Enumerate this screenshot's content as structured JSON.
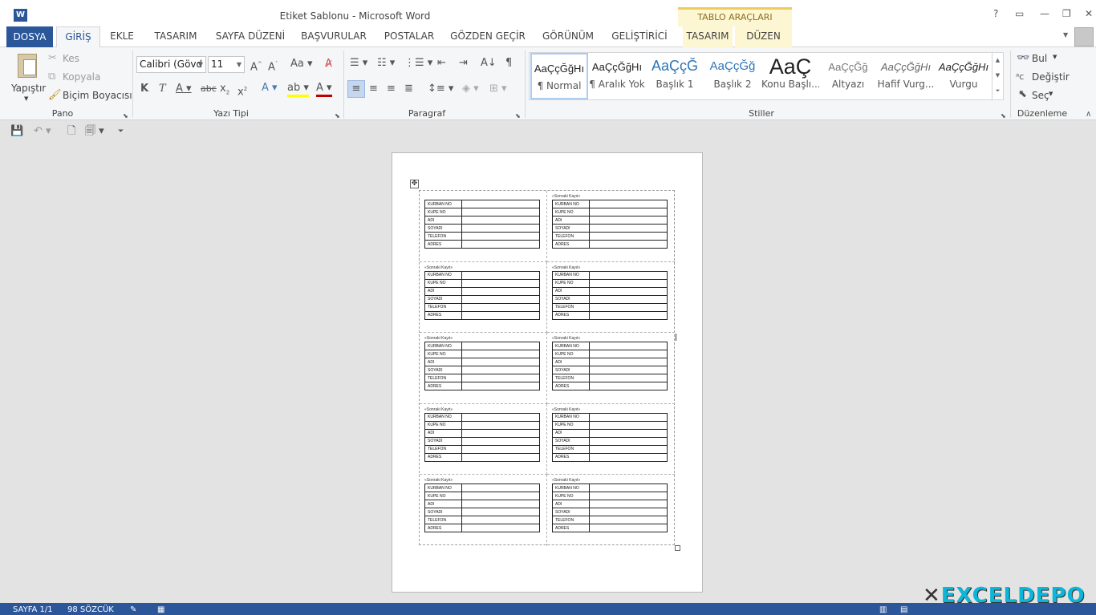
{
  "window": {
    "title": "Etiket Sablonu - Microsoft Word",
    "context_group": "TABLO ARAÇLARI"
  },
  "tabs": [
    "DOSYA",
    "GİRİŞ",
    "EKLE",
    "TASARIM",
    "SAYFA DÜZENİ",
    "BAŞVURULAR",
    "POSTALAR",
    "GÖZDEN GEÇİR",
    "GÖRÜNÜM",
    "GELİŞTİRİCİ",
    "TASARIM",
    "DÜZEN"
  ],
  "clipboard": {
    "paste": "Yapıştır",
    "cut": "Kes",
    "copy": "Kopyala",
    "format_painter": "Biçim Boyacısı",
    "label": "Pano"
  },
  "font": {
    "name": "Calibri (Gövd",
    "size": "11",
    "label": "Yazı Tipi"
  },
  "paragraph": {
    "label": "Paragraf"
  },
  "styles": {
    "label": "Stiller",
    "items": [
      {
        "sample": "AaÇçĞğHı",
        "name": "¶ Normal"
      },
      {
        "sample": "AaÇçĞğHı",
        "name": "¶ Aralık Yok"
      },
      {
        "sample": "AaÇçĞ",
        "name": "Başlık 1"
      },
      {
        "sample": "AaÇçĞğ",
        "name": "Başlık 2"
      },
      {
        "sample": "AaÇ",
        "name": "Konu Başlı..."
      },
      {
        "sample": "AaÇçĞğ",
        "name": "Altyazı"
      },
      {
        "sample": "AaÇçĞğHı",
        "name": "Hafif Vurg..."
      },
      {
        "sample": "AaÇçĞğHı",
        "name": "Vurgu"
      }
    ]
  },
  "editing": {
    "find": "Bul",
    "replace": "Değiştir",
    "select": "Seç",
    "label": "Düzenleme"
  },
  "document": {
    "next_record": "«Sonraki Kayıt»",
    "fields": [
      "KURBAN NO",
      "KUPE NO",
      "ADI",
      "SOYADI",
      "TELEFON",
      "ADRES"
    ]
  },
  "status": {
    "page": "SAYFA 1/1",
    "words": "98 SÖZCÜK"
  },
  "watermark": "EXCELDEPO",
  "colors": {
    "accent": "#2b579a",
    "font_color": "#c00000",
    "highlight": "#ffff00"
  }
}
